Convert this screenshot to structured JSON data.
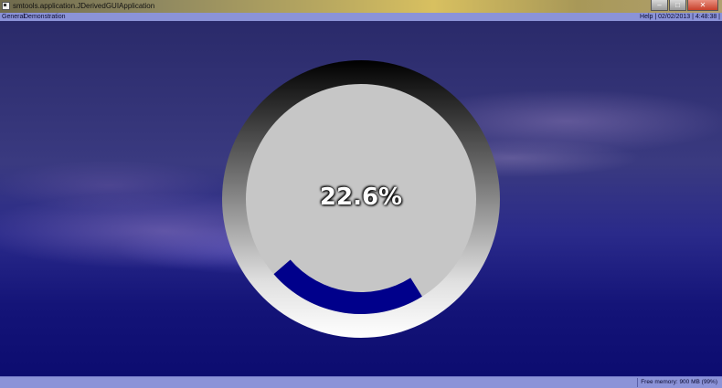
{
  "window": {
    "title": "smtools.application.JDerivedGUIApplication",
    "controls": {
      "minimize": "–",
      "maximize": "□",
      "close": "✕"
    }
  },
  "menubar": {
    "items": [
      "General",
      "Demonstration"
    ],
    "right_text": "Help | 02/02/2013 | 4:48:38 |"
  },
  "progress": {
    "label": "22.6%",
    "value": 0.226,
    "fill_color": "#00008b",
    "track_color": "#c8c8c8"
  },
  "statusbar": {
    "memory": "Free memory: 900 MB (99%)"
  },
  "colors": {
    "menubar": "#8b93d8",
    "statusbar": "#8b93d8"
  }
}
